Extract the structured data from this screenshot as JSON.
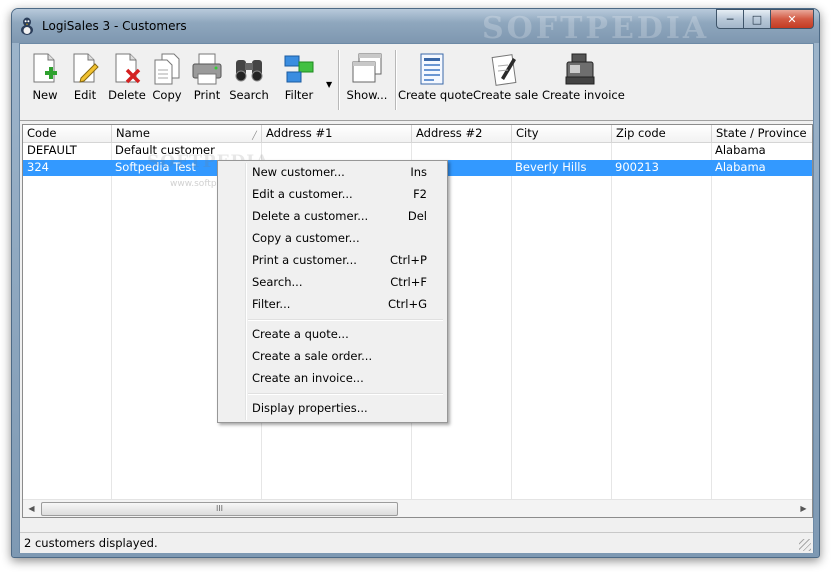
{
  "window": {
    "title": "LogiSales 3 - Customers",
    "title_watermark": "SOFTPEDIA"
  },
  "toolbar": {
    "buttons": [
      {
        "label": "New",
        "icon": "new-document-icon"
      },
      {
        "label": "Edit",
        "icon": "edit-document-icon"
      },
      {
        "label": "Delete",
        "icon": "delete-document-icon"
      },
      {
        "label": "Copy",
        "icon": "copy-document-icon"
      },
      {
        "label": "Print",
        "icon": "printer-icon"
      },
      {
        "label": "Search",
        "icon": "binoculars-icon"
      },
      {
        "label": "Filter",
        "icon": "filter-icon"
      },
      {
        "label": "Show...",
        "icon": "windows-icon"
      },
      {
        "label": "Create quote",
        "icon": "quote-icon"
      },
      {
        "label": "Create sale",
        "icon": "sale-icon"
      },
      {
        "label": "Create invoice",
        "icon": "cash-register-icon"
      }
    ]
  },
  "grid": {
    "columns": [
      "Code",
      "Name",
      "Address #1",
      "Address #2",
      "City",
      "Zip code",
      "State / Province"
    ],
    "rows": [
      {
        "code": "DEFAULT",
        "name": "Default customer",
        "address1": "",
        "address2": "",
        "city": "",
        "zip": "",
        "state": "Alabama",
        "selected": false
      },
      {
        "code": "324",
        "name": "Softpedia Test",
        "address1": "",
        "address2": "",
        "city": "Beverly Hills",
        "zip": "900213",
        "state": "Alabama",
        "selected": true
      }
    ],
    "scroll_thumb": "III"
  },
  "status": {
    "text": "2 customers displayed."
  },
  "context_menu": {
    "items": [
      {
        "label": "New customer...",
        "shortcut": "Ins"
      },
      {
        "label": "Edit a customer...",
        "shortcut": "F2"
      },
      {
        "label": "Delete a customer...",
        "shortcut": "Del"
      },
      {
        "label": "Copy a customer...",
        "shortcut": ""
      },
      {
        "label": "Print a customer...",
        "shortcut": "Ctrl+P"
      },
      {
        "label": "Search...",
        "shortcut": "Ctrl+F"
      },
      {
        "label": "Filter...",
        "shortcut": "Ctrl+G"
      },
      {
        "label": "Create a quote...",
        "shortcut": ""
      },
      {
        "label": "Create a sale order...",
        "shortcut": ""
      },
      {
        "label": "Create an invoice...",
        "shortcut": ""
      },
      {
        "label": "Display properties...",
        "shortcut": ""
      }
    ]
  },
  "overlay_watermark": {
    "main": "SOFTPEDIA",
    "small": "www.softpedia.com"
  },
  "colors": {
    "selection": "#3399ff",
    "titlebar": "#8fa7be",
    "close_button": "#c33b22",
    "menu_bg": "#f0f0f0"
  }
}
